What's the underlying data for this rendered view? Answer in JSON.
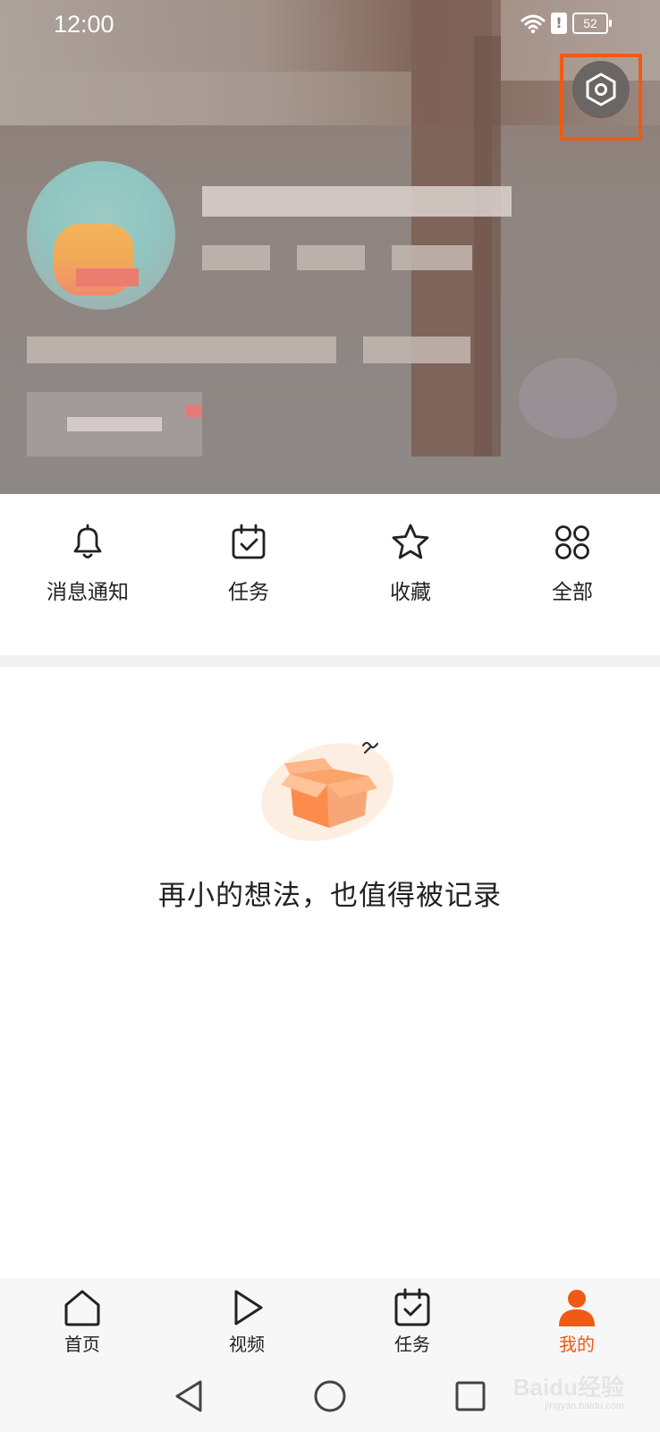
{
  "status_bar": {
    "time": "12:00",
    "battery": "52",
    "alert": "!"
  },
  "header": {
    "settings_icon": "settings-hexagon-icon"
  },
  "quick_actions": [
    {
      "label": "消息通知",
      "icon": "bell-icon"
    },
    {
      "label": "任务",
      "icon": "calendar-check-icon"
    },
    {
      "label": "收藏",
      "icon": "star-icon"
    },
    {
      "label": "全部",
      "icon": "grid-circles-icon"
    }
  ],
  "empty_state": {
    "icon": "open-box-icon",
    "message": "再小的想法，也值得被记录"
  },
  "tabbar": {
    "items": [
      {
        "label": "首页",
        "icon": "home-icon"
      },
      {
        "label": "视频",
        "icon": "play-icon"
      },
      {
        "label": "任务",
        "icon": "calendar-check-icon"
      },
      {
        "label": "我的",
        "icon": "person-icon",
        "active": true
      }
    ]
  },
  "system_nav": [
    "back-icon",
    "home-circle-icon",
    "recents-icon"
  ],
  "watermark": {
    "brand": "Baidu经验",
    "url": "jingyan.baidu.com"
  },
  "colors": {
    "accent": "#f05a12",
    "text": "#222222",
    "tabbar_bg": "#f7f7f7"
  }
}
